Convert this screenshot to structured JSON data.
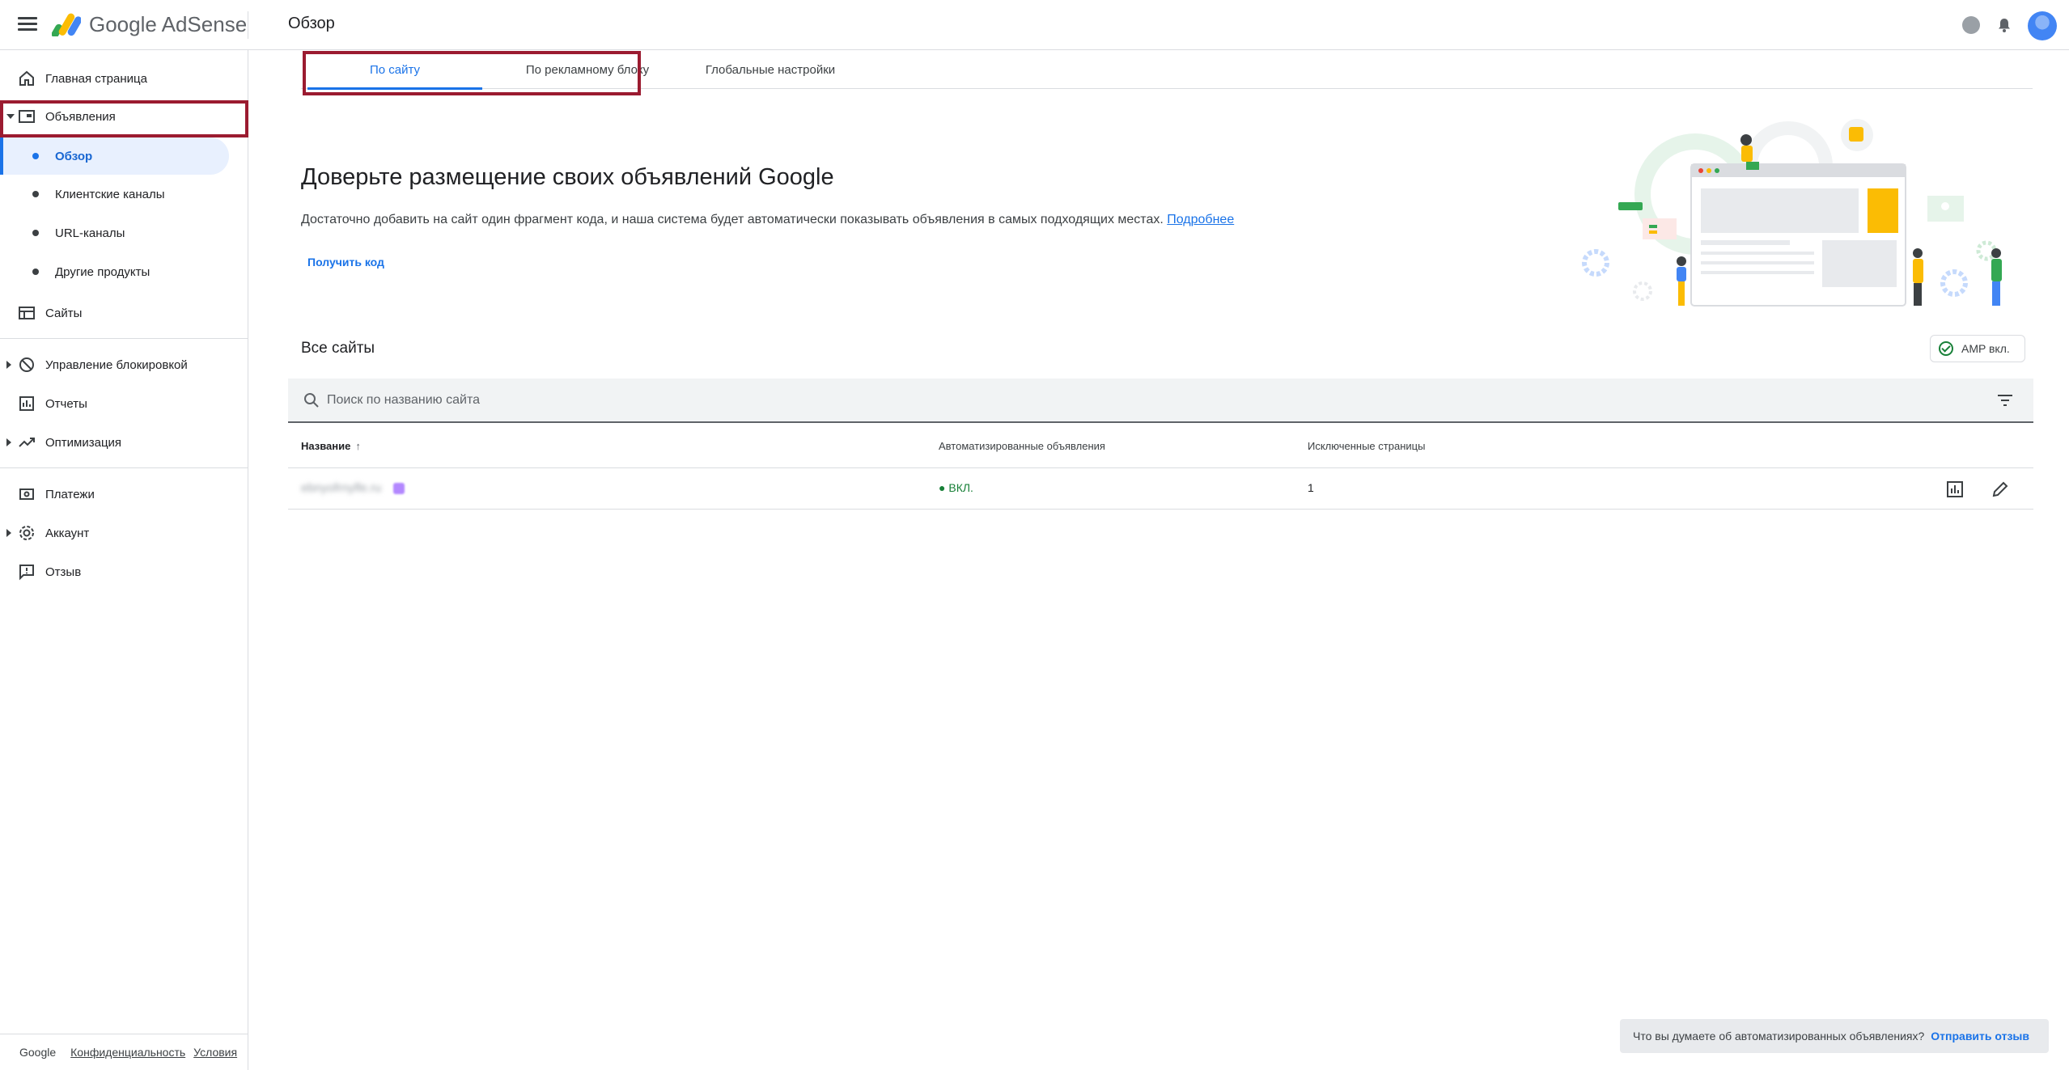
{
  "app": {
    "logo_text": "Google AdSense",
    "page_title": "Обзор"
  },
  "colors": {
    "accent": "#1a73e8",
    "active_bg": "#e8f0fe",
    "status_on": "#188038",
    "highlight_border": "#9b1b30"
  },
  "sidebar": {
    "home": "Главная страница",
    "ads": "Объявления",
    "ads_sub": [
      "Обзор",
      "Клиентские каналы",
      "URL-каналы",
      "Другие продукты"
    ],
    "sites": "Сайты",
    "blocking": "Управление блокировкой",
    "reports": "Отчеты",
    "optimization": "Оптимизация",
    "payments": "Платежи",
    "account": "Аккаунт",
    "feedback": "Отзыв"
  },
  "footer": {
    "google": "Google",
    "privacy": "Конфиденциальность",
    "terms": "Условия"
  },
  "tabs": [
    "По сайту",
    "По рекламному блоку",
    "Глобальные настройки"
  ],
  "hero": {
    "title": "Доверьте размещение своих объявлений Google",
    "description": "Достаточно добавить на сайт один фрагмент кода, и наша система будет автоматически показывать объявления в самых подходящих местах.",
    "learn_more": "Подробнее",
    "get_code": "Получить код"
  },
  "sites": {
    "title": "Все сайты",
    "amp_chip": "AMP вкл.",
    "search_placeholder": "Поиск по названию сайта",
    "columns": [
      "Название",
      "Автоматизированные объявления",
      "Исключенные страницы"
    ],
    "rows": [
      {
        "site": "ebnyofrnylfe.ru",
        "auto_ads": "ВКЛ.",
        "excluded": "1"
      }
    ]
  },
  "feedback_bar": {
    "question": "Что вы думаете об автоматизированных объявлениях?",
    "action": "Отправить отзыв"
  },
  "icons": {
    "menu": "menu-icon",
    "help": "help-icon",
    "notifications": "bell-icon",
    "search": "search-icon",
    "filter": "filter-icon",
    "report": "bar-chart-icon",
    "edit": "pencil-icon"
  }
}
